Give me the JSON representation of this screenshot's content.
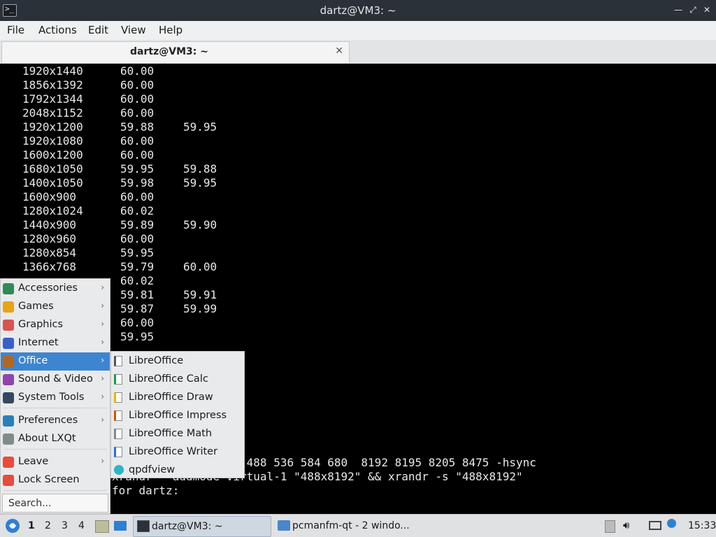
{
  "window": {
    "title": "dartz@VM3: ~",
    "controls": {
      "minimize": "—",
      "restore": "⤢",
      "close": "✕"
    }
  },
  "menubar": {
    "items": [
      "File",
      "Actions",
      "Edit",
      "View",
      "Help"
    ]
  },
  "tabs": [
    {
      "label": "dartz@VM3: ~",
      "close": "✕"
    }
  ],
  "terminal": {
    "modes": [
      {
        "res": "1920x1440",
        "r1": "60.00",
        "r2": ""
      },
      {
        "res": "1856x1392",
        "r1": "60.00",
        "r2": ""
      },
      {
        "res": "1792x1344",
        "r1": "60.00",
        "r2": ""
      },
      {
        "res": "2048x1152",
        "r1": "60.00",
        "r2": ""
      },
      {
        "res": "1920x1200",
        "r1": "59.88",
        "r2": "59.95"
      },
      {
        "res": "1920x1080",
        "r1": "60.00",
        "r2": ""
      },
      {
        "res": "1600x1200",
        "r1": "60.00",
        "r2": ""
      },
      {
        "res": "1680x1050",
        "r1": "59.95",
        "r2": "59.88"
      },
      {
        "res": "1400x1050",
        "r1": "59.98",
        "r2": "59.95"
      },
      {
        "res": "1600x900",
        "r1": "60.00",
        "r2": ""
      },
      {
        "res": "1280x1024",
        "r1": "60.02",
        "r2": ""
      },
      {
        "res": "1440x900",
        "r1": "59.89",
        "r2": "59.90"
      },
      {
        "res": "1280x960",
        "r1": "60.00",
        "r2": ""
      },
      {
        "res": "1280x854",
        "r1": "59.95",
        "r2": ""
      },
      {
        "res": "1366x768",
        "r1": "59.79",
        "r2": "60.00"
      },
      {
        "res": "",
        "r1": "60.02",
        "r2": ""
      },
      {
        "res": "",
        "r1": "59.81",
        "r2": "59.91"
      },
      {
        "res": "",
        "r1": "59.87",
        "r2": "59.99"
      },
      {
        "res": "",
        "r1": "60.00",
        "r2": ""
      },
      {
        "res": "",
        "r1": "59.95",
        "r2": ""
      }
    ],
    "tail_lines": [
      "\"488x8192\"  345.75  488 536 584 680  8192 8195 8205 8475 -hsync",
      "xrandr --addmode Virtual-1 \"488x8192\" && xrandr -s \"488x8192\"",
      "for dartz:"
    ]
  },
  "start_menu": {
    "items": [
      {
        "label": "Accessories",
        "icon": "accessories-icon",
        "color": "#2e8b57",
        "arrow": "›"
      },
      {
        "label": "Games",
        "icon": "games-icon",
        "color": "#e8a317",
        "arrow": "›"
      },
      {
        "label": "Graphics",
        "icon": "graphics-icon",
        "color": "#d9534f",
        "arrow": "›"
      },
      {
        "label": "Internet",
        "icon": "internet-icon",
        "color": "#3a5fcd",
        "arrow": "›"
      },
      {
        "label": "Office",
        "icon": "office-icon",
        "color": "#b5651d",
        "arrow": "›"
      },
      {
        "label": "Sound & Video",
        "icon": "sound-video-icon",
        "color": "#8e44ad",
        "arrow": "›"
      },
      {
        "label": "System Tools",
        "icon": "system-tools-icon",
        "color": "#34495e",
        "arrow": "›"
      },
      {
        "label": "Preferences",
        "icon": "preferences-icon",
        "color": "#2980b9",
        "arrow": "›"
      },
      {
        "label": "About LXQt",
        "icon": "about-icon",
        "color": "#7f8c8d",
        "arrow": ""
      },
      {
        "label": "Leave",
        "icon": "leave-icon",
        "color": "#e74c3c",
        "arrow": "›"
      },
      {
        "label": "Lock Screen",
        "icon": "lock-icon",
        "color": "#e74c3c",
        "arrow": ""
      }
    ],
    "search_placeholder": "Search..."
  },
  "office_submenu": {
    "items": [
      {
        "label": "LibreOffice",
        "icon": "libreoffice-icon",
        "color": "#555555"
      },
      {
        "label": "LibreOffice Calc",
        "icon": "libreoffice-calc-icon",
        "color": "#1e9e3a"
      },
      {
        "label": "LibreOffice Draw",
        "icon": "libreoffice-draw-icon",
        "color": "#e6b800"
      },
      {
        "label": "LibreOffice Impress",
        "icon": "libreoffice-impress-icon",
        "color": "#d35400"
      },
      {
        "label": "LibreOffice Math",
        "icon": "libreoffice-math-icon",
        "color": "#7f8c8d"
      },
      {
        "label": "LibreOffice Writer",
        "icon": "libreoffice-writer-icon",
        "color": "#2a6fdb"
      },
      {
        "label": "qpdfview",
        "icon": "qpdfview-icon",
        "color": "#2bb5c5"
      }
    ]
  },
  "taskbar": {
    "desktops": [
      "1",
      "2",
      "3",
      "4"
    ],
    "tasks": [
      {
        "label": "dartz@VM3: ~",
        "icon": "terminal-icon"
      },
      {
        "label": "pcmanfm-qt - 2 windo...",
        "icon": "folder-icon"
      }
    ],
    "clock": "15:33",
    "colors": {
      "accent": "#3d85d0"
    }
  }
}
